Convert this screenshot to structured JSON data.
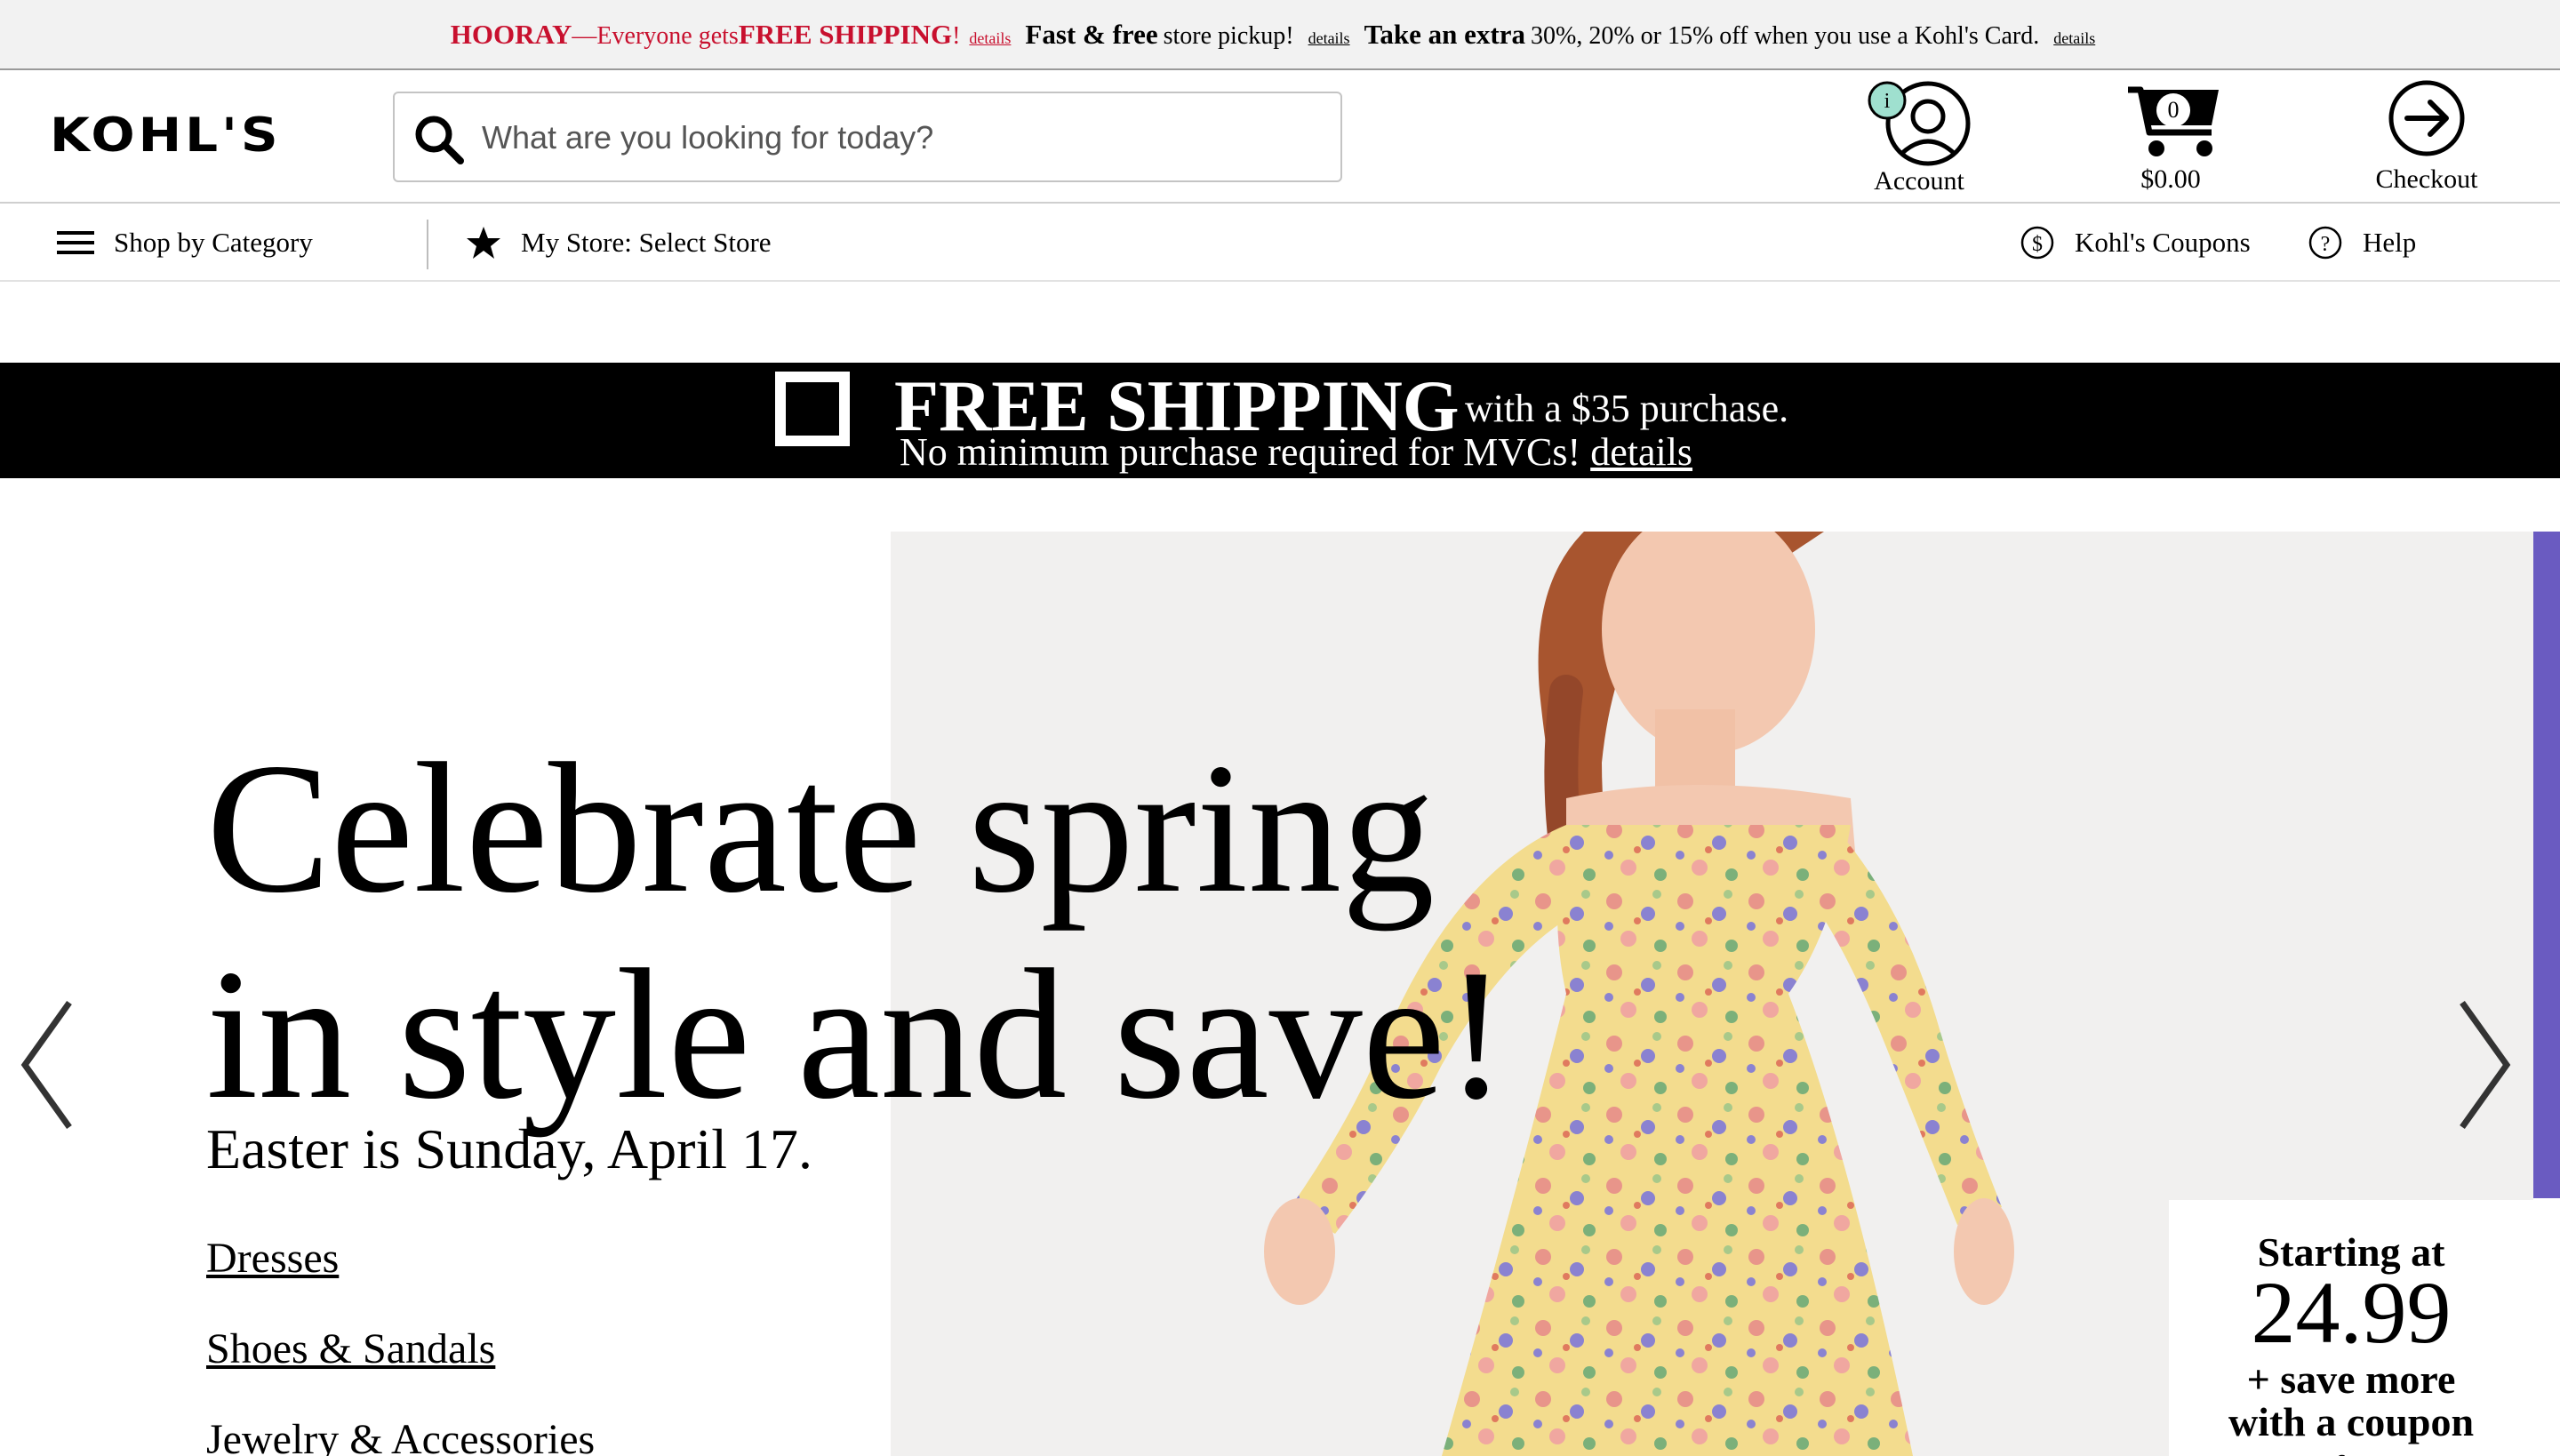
{
  "promo": {
    "hooray": "HOORAY",
    "dash_text": "—Everyone gets ",
    "free_shipping": "FREE SHIPPING",
    "excl": "!",
    "details1": "details",
    "fast_free": "Fast & free",
    "pickup": "store pickup!",
    "details2": "details",
    "take_extra": "Take an extra",
    "discount_text": "30%, 20% or 15% off when you use a Kohl's Card.",
    "details3": "details"
  },
  "header": {
    "logo": "KOHL'S",
    "search_placeholder": "What are you looking for today?",
    "account_label": "Account",
    "cart_count": "0",
    "cart_total": "$0.00",
    "checkout_label": "Checkout"
  },
  "subnav": {
    "shop_by_category": "Shop by Category",
    "my_store": "My Store: Select Store",
    "coupons": "Kohl's Coupons",
    "help": "Help"
  },
  "shipping_banner": {
    "headline": "FREE SHIPPING",
    "with_purchase": "with a $35 purchase.",
    "line2": "No minimum purchase required for MVCs!",
    "details": "details"
  },
  "hero": {
    "headline_line1": "Celebrate spring",
    "headline_line2": "in style and save!",
    "subhead": "Easter is Sunday, April 17.",
    "links": [
      "Dresses",
      "Shoes & Sandals",
      "Jewelry & Accessories"
    ],
    "price_card": {
      "starting": "Starting at",
      "price": "24.99",
      "save_line1": "+ save more",
      "save_line2": "with a coupon",
      "category": "Dresses for women"
    }
  },
  "colors": {
    "promo_red": "#c8102e",
    "banner_black": "#000000",
    "accent_purple": "#6a5bc1"
  }
}
